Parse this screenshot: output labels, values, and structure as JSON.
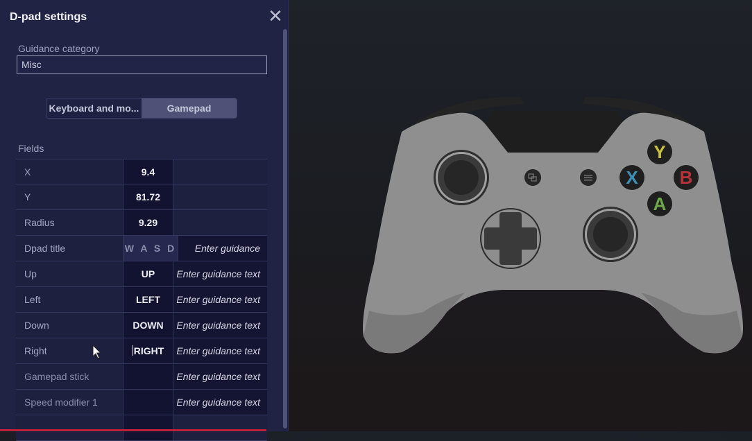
{
  "panel": {
    "title": "D-pad settings",
    "close_icon": "close-icon",
    "guidance_category_label": "Guidance category",
    "guidance_category_value": "Misc",
    "mode_tabs": [
      {
        "label": "Keyboard and mo...",
        "selected": false
      },
      {
        "label": "Gamepad",
        "selected": true
      }
    ],
    "fields_label": "Fields",
    "fields": [
      {
        "name": "X",
        "value": "9.4",
        "guidance": ""
      },
      {
        "name": "Y",
        "value": "81.72",
        "guidance": ""
      },
      {
        "name": "Radius",
        "value": "9.29",
        "guidance": ""
      },
      {
        "name": "Dpad title",
        "value": "W A S D",
        "guidance": "Enter guidance text"
      },
      {
        "name": "Up",
        "value": "UP",
        "guidance": "Enter guidance text"
      },
      {
        "name": "Left",
        "value": "LEFT",
        "guidance": "Enter guidance text"
      },
      {
        "name": "Down",
        "value": "DOWN",
        "guidance": "Enter guidance text"
      },
      {
        "name": "Right",
        "value": "RIGHT",
        "guidance": "Enter guidance text"
      },
      {
        "name": "Gamepad stick",
        "value": "",
        "guidance": "Enter guidance text"
      },
      {
        "name": "Speed modifier 1",
        "value": "",
        "guidance": "Enter guidance text"
      },
      {
        "name": "",
        "value": "",
        "guidance": ""
      }
    ]
  },
  "controller": {
    "face_buttons": [
      {
        "label": "Y",
        "color": "#c9c23a"
      },
      {
        "label": "X",
        "color": "#3d8fb5"
      },
      {
        "label": "B",
        "color": "#b8323a"
      },
      {
        "label": "A",
        "color": "#6fa848"
      }
    ],
    "body_color": "#8e8e8e",
    "accent_dark": "#2a2a2a"
  }
}
